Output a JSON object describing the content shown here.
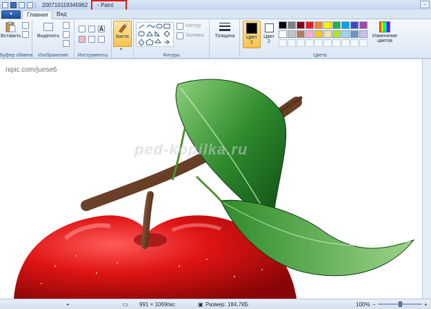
{
  "titlebar": {
    "filename": "200710119345962",
    "app_name": "Paint",
    "separator": "-"
  },
  "tabs": {
    "file_menu_icon": "paint-menu-icon",
    "home": "Главная",
    "view": "Вид"
  },
  "ribbon": {
    "clipboard": {
      "paste": "Вставить",
      "label": "Буфер обмена"
    },
    "image": {
      "select": "Выделить",
      "label": "Изображение"
    },
    "tools": {
      "label": "Инструменты"
    },
    "brushes": {
      "label": "Кисти"
    },
    "shapes": {
      "outline": "Контур",
      "fill": "Заливка",
      "label": "Фигуры"
    },
    "size": {
      "label": "Толщина"
    },
    "colors": {
      "color1": "Цвет",
      "color1_num": "1",
      "color2": "Цвет",
      "color2_num": "2",
      "edit": "Изменение цветов",
      "label": "Цвета",
      "palette_row1": [
        "#000000",
        "#7f7f7f",
        "#880015",
        "#ed1c24",
        "#ff7f27",
        "#fff200",
        "#22b14c",
        "#00a2e8",
        "#3f48cc",
        "#a349a4"
      ],
      "palette_row2": [
        "#ffffff",
        "#c3c3c3",
        "#b97a57",
        "#ffaec9",
        "#ffc90e",
        "#efe4b0",
        "#b5e61d",
        "#99d9ea",
        "#7092be",
        "#c8bfe7"
      ]
    }
  },
  "canvas": {
    "watermark_top": "nipic.com/juese6",
    "watermark_mid": "ped-kopilka.ru"
  },
  "status": {
    "dimensions": "991 × 1069пкс",
    "size": "Размер: 184,7КБ",
    "zoom": "100%"
  }
}
